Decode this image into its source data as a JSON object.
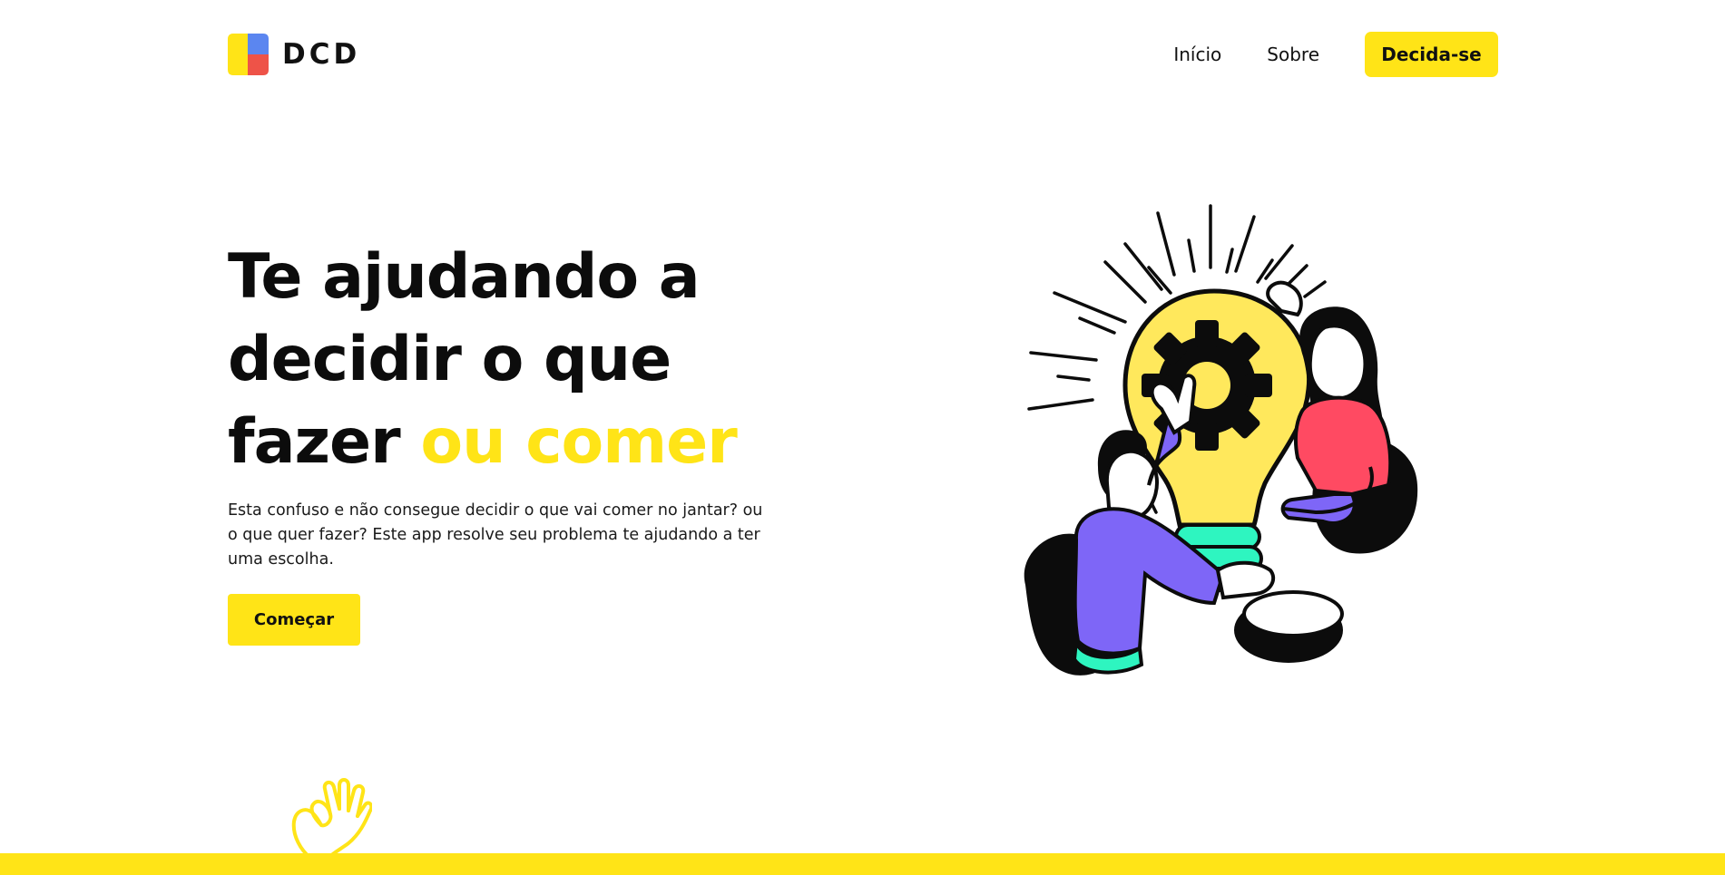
{
  "brand": {
    "name": "DCD",
    "logo_icon": "color-blocks-logo",
    "colors": {
      "accent": "#ffe417",
      "logo_blue": "#5b86f0",
      "logo_red": "#ee5348",
      "illustration_purple": "#7e66f7",
      "illustration_pink": "#ff4a62",
      "illustration_mint": "#2ef5c0",
      "bulb_yellow": "#ffe85c",
      "ink": "#0c0c0c"
    }
  },
  "nav": {
    "links": [
      {
        "label": "Início"
      },
      {
        "label": "Sobre"
      }
    ],
    "cta": "Decida-se"
  },
  "hero": {
    "title_main": "Te ajudando a decidir o que fazer",
    "title_accent": "ou comer",
    "description": "Esta confuso e não consegue decidir o que vai comer no jantar? ou o que quer fazer? Este app resolve seu problema te ajudando a ter uma escolha.",
    "button": "Começar",
    "illustration_icon": "lightbulb-teamwork-illustration"
  },
  "footer": {
    "icon": "ok-hand-icon"
  }
}
